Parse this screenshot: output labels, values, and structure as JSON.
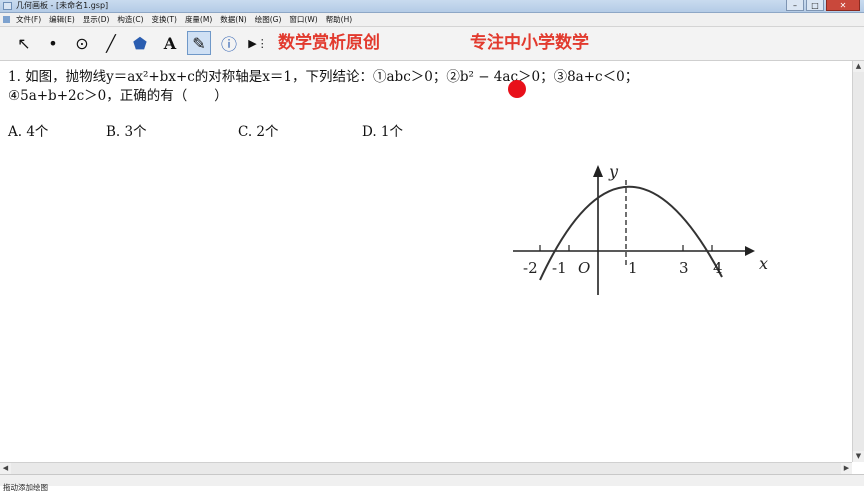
{
  "window": {
    "title": "几何画板 - [未命名1.gsp]",
    "min": "–",
    "max": "□",
    "close": "✕"
  },
  "menu": [
    "文件(F)",
    "编辑(E)",
    "显示(D)",
    "构造(C)",
    "变换(T)",
    "度量(M)",
    "数据(N)",
    "绘图(G)",
    "窗口(W)",
    "帮助(H)"
  ],
  "toolbar": {
    "tools": [
      {
        "name": "arrow-select-tool",
        "glyph": "↖"
      },
      {
        "name": "point-tool",
        "glyph": "•"
      },
      {
        "name": "compass-tool",
        "glyph": "⊙"
      },
      {
        "name": "straightedge-tool",
        "glyph": "╱"
      },
      {
        "name": "polygon-tool",
        "glyph": "⬟"
      },
      {
        "name": "text-tool",
        "glyph": "A"
      },
      {
        "name": "marker-tool",
        "glyph": "✎"
      },
      {
        "name": "information-tool",
        "glyph": "ⓘ"
      },
      {
        "name": "custom-tool",
        "glyph": "▶⋮"
      }
    ],
    "active_tool": "marker-tool",
    "banner_left": "数学赏析原创",
    "banner_right": "专注中小学数学",
    "banner_color": "#e23a2e"
  },
  "question": {
    "line1": "1. 如图，抛物线y＝ax²+bx+c的对称轴是x＝1，下列结论：①abc＞0；②b² − 4ac＞0；③8a+c＜0；",
    "line2": "④5a+b+2c＞0，正确的有（　　）"
  },
  "options": [
    "A. 4个",
    "B. 3个",
    "C. 2个",
    "D. 1个"
  ],
  "figure": {
    "x_axis_label": "x",
    "y_axis_label": "y",
    "origin_label": "O",
    "tick_labels": [
      "-2",
      "-1",
      "1",
      "3",
      "4"
    ]
  },
  "status": {
    "text": "拖动添加绘图"
  },
  "colors": {
    "marker_dot": "#e8101a",
    "titlebar": "#c9dbef",
    "close": "#c9483b"
  }
}
